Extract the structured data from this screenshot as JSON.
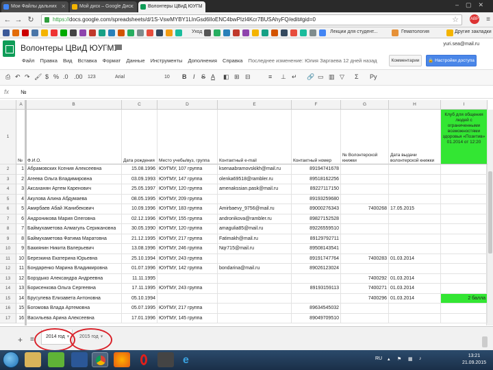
{
  "browser": {
    "tabs": [
      {
        "label": "Мои Файлы дальних",
        "color": "#4285f4"
      },
      {
        "label": "Мой диск – Google Диск",
        "color": "#f4b400"
      },
      {
        "label": "Волонтеры ЦВиД ЮУГМ",
        "color": "#0f9d58",
        "active": true
      }
    ],
    "url_scheme": "https://",
    "url_rest": "docs.google.com/spreadsheets/d/1S-VswMYBY1LInGsd6lIoENC4bwPIzI4Kcr7BUSAhyFQ/edit#gid=0",
    "bookmarks": [
      "Уход",
      "Лекции для студент...",
      "Гематология",
      "Другие закладки"
    ]
  },
  "sheets": {
    "title": "Волонтеры ЦВиД ЮУГМУ",
    "user_email": "yuri.sea@mail.ru",
    "menu": [
      "Файл",
      "Правка",
      "Вид",
      "Вставка",
      "Формат",
      "Данные",
      "Инструменты",
      "Дополнения",
      "Справка"
    ],
    "last_edit": "Последнее изменение: Юлия Заргаева 12 дней назад",
    "comments_label": "Комментарии",
    "share_label": "Настройки доступа",
    "font_name": "Arial",
    "font_size": "10",
    "zoom": "123",
    "formula_value": "№"
  },
  "grid": {
    "columns": [
      "A",
      "B",
      "C",
      "D",
      "E",
      "F",
      "G",
      "H",
      "I"
    ],
    "header_row_label": "1",
    "headers": [
      "№",
      "Ф.И.О.",
      "Дата рождения",
      "Место учебы/вуз, группа",
      "Контактный e-mail",
      "Контактный номер",
      "№ Волонтерской книжки",
      "Дата выдачи волонтерской книжки",
      "Клуб для общения людей с ограниченными возможностями здоровья «Позитив» 01.2014 от 12:20"
    ],
    "rows": [
      {
        "n": "2",
        "a": "1",
        "b": "Абрамовских Ксения Алексеевна",
        "c": "15.08.1996",
        "d": "ЮУГМУ, 107 группа",
        "e": "ksenaabramovskikh@mail.ru",
        "f": "89194741678",
        "g": "",
        "h": "",
        "i": ""
      },
      {
        "n": "3",
        "a": "2",
        "b": "Агеева Ольга Владимировна",
        "c": "03.09.1993",
        "d": "ЮУГМУ, 147 группа",
        "e": "olenka69518@rambler.ru",
        "f": "89518162256",
        "g": "",
        "h": "",
        "i": ""
      },
      {
        "n": "4",
        "a": "3",
        "b": "Аксаханян Артем Каренович",
        "c": "25.05.1997",
        "d": "ЮУГМУ, 120 группа",
        "e": "amenakssian.pask@mail.ru",
        "f": "89227117150",
        "g": "",
        "h": "",
        "i": ""
      },
      {
        "n": "5",
        "a": "4",
        "b": "Акулова Алина Абдумаева",
        "c": "08.05.1995",
        "d": "ЮУГМУ, 209 группа",
        "e": "",
        "f": "89193259680",
        "g": "",
        "h": "",
        "i": ""
      },
      {
        "n": "6",
        "a": "5",
        "b": "Амирбаев Абай Жанибекович",
        "c": "10.09.1996",
        "d": "ЮУГМУ, 183 группа",
        "e": "Amirbaevy_9756@mail.ru",
        "f": "89000276343",
        "g": "7400268",
        "h": "17.05.2015",
        "i": ""
      },
      {
        "n": "7",
        "a": "6",
        "b": "Андроникова Мария Олеговна",
        "c": "02.12.1996",
        "d": "ЮУГМУ, 155 группа",
        "e": "andronikova@rambler.ru",
        "f": "89827152528",
        "g": "",
        "h": "",
        "i": ""
      },
      {
        "n": "8",
        "a": "7",
        "b": "Баймухаметова Алмагуль Серикановна",
        "c": "30.05.1990",
        "d": "ЮУГМУ, 120 группа",
        "e": "amagulia85@mail.ru",
        "f": "89226559510",
        "g": "",
        "h": "",
        "i": ""
      },
      {
        "n": "9",
        "a": "8",
        "b": "Баймухаметова Фатима Маратовна",
        "c": "21.12.1995",
        "d": "ЮУГМУ, 217 группа",
        "e": "Fatimakh@mail.ru",
        "f": "89129792711",
        "g": "",
        "h": "",
        "i": ""
      },
      {
        "n": "10",
        "a": "9",
        "b": "Бакиянин Никита Валерьевич",
        "c": "13.08.1996",
        "d": "ЮУГМУ, 246 группа",
        "e": "Nqr715@mail.ru",
        "f": "89508143541",
        "g": "",
        "h": "",
        "i": ""
      },
      {
        "n": "11",
        "a": "10",
        "b": "Березкина Екатерина Юрьевна",
        "c": "25.10.1994",
        "d": "ЮУГМУ, 243 группа",
        "e": "",
        "f": "89191747764",
        "g": "7400283",
        "h": "01.03.2014",
        "i": ""
      },
      {
        "n": "12",
        "a": "11",
        "b": "Бондаренко Марина Владимировна",
        "c": "01.07.1996",
        "d": "ЮУГМУ, 142 группа",
        "e": "bondarina@mail.ru",
        "f": "89026123024",
        "g": "",
        "h": "",
        "i": ""
      },
      {
        "n": "13",
        "a": "12",
        "b": "Борздыко Александра Андреевна",
        "c": "11.11.1995",
        "d": "",
        "e": "",
        "f": "",
        "g": "7400292",
        "h": "01.03.2014",
        "i": ""
      },
      {
        "n": "14",
        "a": "13",
        "b": "Борисенкова Ольга Сергеевна",
        "c": "17.11.1995",
        "d": "ЮУГМУ, 243 группа",
        "e": "",
        "f": "89193159113",
        "g": "7400271",
        "h": "01.03.2014",
        "i": ""
      },
      {
        "n": "15",
        "a": "14",
        "b": "Брусулева Елизавета Антоновна",
        "c": "05.10.1994",
        "d": "",
        "e": "",
        "f": "",
        "g": "7400296",
        "h": "01.03.2014",
        "i": "2 балла",
        "green": true
      },
      {
        "n": "16",
        "a": "15",
        "b": "Богомова Влада Артемовна",
        "c": "05.07.1995",
        "d": "ЮУГМУ, 217 группа",
        "e": "",
        "f": "89634545032",
        "g": "",
        "h": "",
        "i": ""
      },
      {
        "n": "17",
        "a": "16",
        "b": "Васильева Арина Алексеевна",
        "c": "17.01.1996",
        "d": "ЮУГМУ, 145 группа",
        "e": "",
        "f": "89049709510",
        "g": "",
        "h": "",
        "i": ""
      }
    ]
  },
  "sheet_tabs": {
    "active": "2014 год",
    "other": "2015 год"
  },
  "taskbar": {
    "lang": "RU",
    "time": "13:21",
    "date": "21.09.2015"
  }
}
